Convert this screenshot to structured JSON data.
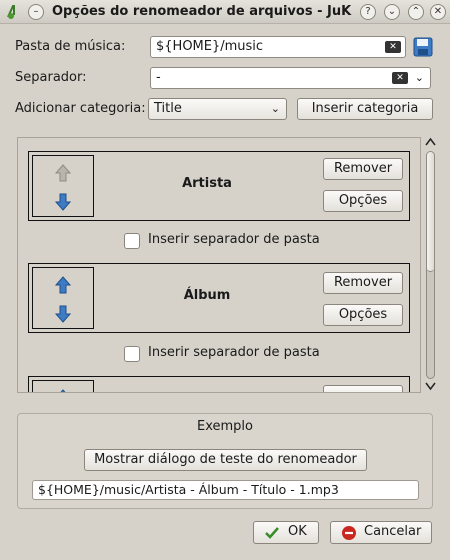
{
  "window": {
    "title": "Opções do renomeador de arquivos - JuK",
    "buttons": [
      "?",
      "⌄",
      "⌃",
      "✕"
    ]
  },
  "form": {
    "music_folder_label": "Pasta de música:",
    "music_folder_value": "${HOME}/music",
    "separator_label": "Separador:",
    "separator_value": "-",
    "add_category_label": "Adicionar categoria:",
    "category_selected": "Title",
    "insert_category_button": "Inserir categoria"
  },
  "categories": [
    {
      "name": "Artista",
      "up_enabled": false,
      "remove": "Remover",
      "options": "Opções"
    },
    {
      "name": "Álbum",
      "up_enabled": true,
      "remove": "Remover",
      "options": "Opções"
    }
  ],
  "separators": [
    "Inserir separador de pasta",
    "Inserir separador de pasta"
  ],
  "example": {
    "title": "Exemplo",
    "show_dialog_button": "Mostrar diálogo de teste do renomeador",
    "example_text": "${HOME}/music/Artista - Álbum - Título - 1.mp3"
  },
  "footer": {
    "ok_label": "OK",
    "cancel_label": "Cancelar"
  },
  "colors": {
    "window_bg": "#d6d2ca",
    "arrow_blue": "#3d7bc4",
    "cancel_red": "#c8281e",
    "ok_green": "#3a8c2a"
  }
}
